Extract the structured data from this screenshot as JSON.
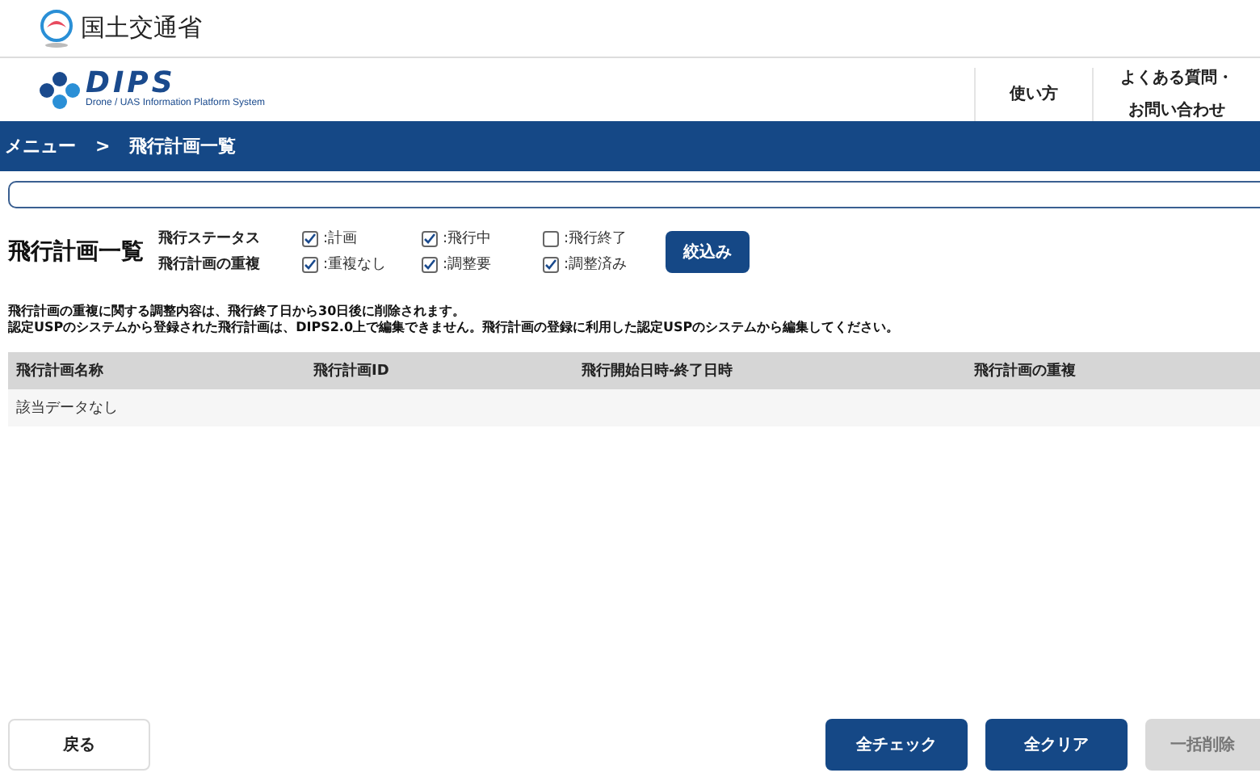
{
  "ministry": "国土交通省",
  "logo": {
    "name": "DIPS",
    "tagline": "Drone / UAS Information Platform System"
  },
  "nav": [
    {
      "lines": [
        "使い方"
      ]
    },
    {
      "lines": [
        "よくある質問・",
        "お問い合わせ"
      ]
    }
  ],
  "breadcrumb": [
    "メニュー",
    "飛行計画一覧"
  ],
  "breadcrumb_separator": ">",
  "page_title": "飛行計画一覧",
  "filters": [
    {
      "label": "飛行ステータス",
      "options": [
        {
          "label": ":計画",
          "checked": true
        },
        {
          "label": ":飛行中",
          "checked": true
        },
        {
          "label": ":飛行終了",
          "checked": false
        }
      ]
    },
    {
      "label": "飛行計画の重複",
      "options": [
        {
          "label": ":重複なし",
          "checked": true
        },
        {
          "label": ":調整要",
          "checked": true
        },
        {
          "label": ":調整済み",
          "checked": true
        }
      ]
    }
  ],
  "filter_button": "絞込み",
  "notes": [
    "飛行計画の重複に関する調整内容は、飛行終了日から30日後に削除されます。",
    "認定USPのシステムから登録された飛行計画は、DIPS2.0上で編集できません。飛行計画の登録に利用した認定USPのシステムから編集してください。"
  ],
  "table": {
    "columns": [
      "飛行計画名称",
      "飛行計画ID",
      "飛行開始日時-終了日時",
      "飛行計画の重複"
    ],
    "empty_message": "該当データなし"
  },
  "back_button": "戻る",
  "actions": [
    {
      "label": "全チェック",
      "disabled": false
    },
    {
      "label": "全クリア",
      "disabled": false
    },
    {
      "label": "一括削除",
      "disabled": true
    }
  ]
}
